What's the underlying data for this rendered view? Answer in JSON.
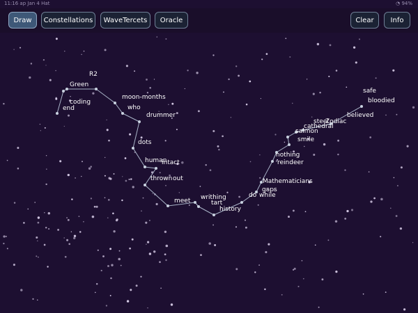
{
  "status_bar": {
    "time": "11:16 ap",
    "date": "Jan 4 Hat",
    "battery": "94%"
  },
  "toolbar": {
    "draw": "Draw",
    "constellations": "Constellations",
    "wavetercets": "WaveTercets",
    "oracle": "Oracle",
    "clear": "Clear",
    "info": "Info"
  },
  "constellation_words": [
    "R2",
    "Green",
    "coding",
    "end",
    "moon-months",
    "who",
    "drummer",
    "dots",
    "human",
    "intact",
    "thrown",
    "out",
    "meet",
    "writhing",
    "tart",
    "history",
    "do",
    "while",
    "gaps",
    "Mathematicians",
    "reindeer",
    "nothing",
    "smile",
    "salmon",
    "cathedral",
    "steel",
    "Zodiac",
    "believed",
    "bloodied",
    "safe"
  ]
}
